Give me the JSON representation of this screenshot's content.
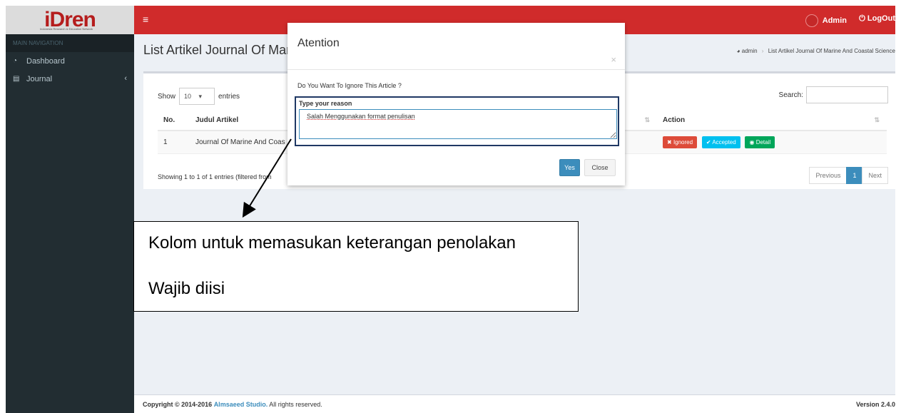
{
  "header": {
    "logo_text": "iDren",
    "logo_subtitle": "Indonesia Research & Education Network",
    "menu_icon": "hamburger-icon",
    "user_name": "Admin",
    "logout_label": "LogOut"
  },
  "sidebar": {
    "nav_header": "MAIN NAVIGATION",
    "items": [
      {
        "label": "Dashboard",
        "icon": "dashboard-icon"
      },
      {
        "label": "Journal",
        "icon": "book-icon"
      }
    ]
  },
  "page": {
    "title": "List Artikel Journal Of Mar",
    "breadcrumb": [
      "admin",
      "List Artikel Journal Of Marine And Coastal Science"
    ]
  },
  "table": {
    "show_label": "Show",
    "entries_value": "10",
    "entries_label": "entries",
    "search_label": "Search:",
    "columns": [
      "No.",
      "Judul Artikel",
      "Action"
    ],
    "rows": [
      {
        "no": "1",
        "title": "Journal Of Marine And Coas"
      }
    ],
    "actions": [
      "Ignored",
      "Accepted",
      "Detail"
    ],
    "info": "Showing 1 to 1 of 1 entries (filtered from",
    "pagination": [
      "Previous",
      "1",
      "Next"
    ]
  },
  "footer": {
    "copyright": "Copyright © 2014-2016",
    "studio": "Almsaeed Studio.",
    "rights": "All rights reserved.",
    "version": "Version 2.4.0"
  },
  "modal": {
    "title": "Atention",
    "close_x": "×",
    "question": "Do You Want To Ignore This Article ?",
    "reason_label": "Type your reason",
    "reason_value": "Salah Menggunakan format penulisan",
    "yes_label": "Yes",
    "close_label": "Close"
  },
  "annotation": {
    "line1": "Kolom untuk memasukan keterangan penolakan",
    "line2": "Wajib diisi"
  },
  "colors": {
    "topbar": "#d02b2b",
    "sidebar": "#222d32",
    "primary": "#3c8dbc",
    "danger": "#dd4b39",
    "info": "#00c0ef",
    "success": "#00a65a"
  }
}
